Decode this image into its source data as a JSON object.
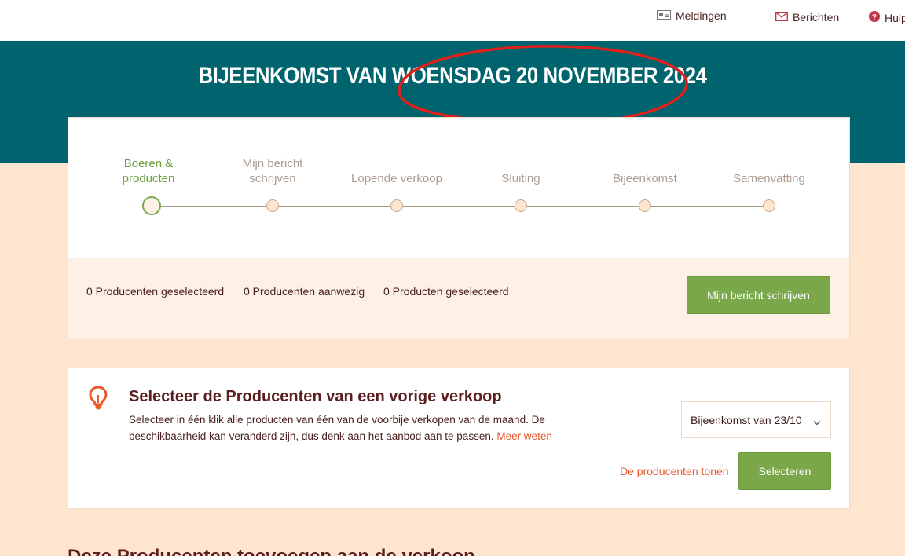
{
  "header": {
    "nav": [
      {
        "label": "Meldingen",
        "icon": "newspaper-icon"
      },
      {
        "label": "Berichten",
        "icon": "envelope-icon"
      },
      {
        "label": "Hulp",
        "icon": "question-circle-icon"
      }
    ]
  },
  "banner": {
    "title": "BIJEENKOMST VAN WOENSDAG 20 NOVEMBER 2024",
    "color": "#00646e"
  },
  "stepper": {
    "steps": [
      {
        "label": "Boeren & producten",
        "active": true
      },
      {
        "label": "Mijn bericht schrijven",
        "active": false
      },
      {
        "label": "Lopende verkoop",
        "active": false
      },
      {
        "label": "Sluiting",
        "active": false
      },
      {
        "label": "Bijeenkomst",
        "active": false
      },
      {
        "label": "Samenvatting",
        "active": false
      }
    ]
  },
  "stats": {
    "producers_selected": "0 Producenten geselecteerd",
    "producers_present": "0 Producenten aanwezig",
    "products_selected": "0 Producten geselecteerd",
    "next_button": "Mijn bericht schrijven"
  },
  "previous_sale": {
    "title": "Selecteer de Producenten van een vorige verkoop",
    "description": "Selecteer in één klik alle producten van één van de voorbije verkopen van de maand. De beschikbaarheid kan veranderd zijn, dus denk aan het aanbod aan te passen.",
    "learn_more": "Meer weten",
    "select_value": "Bijeenkomst van 23/10",
    "show_producers": "De producenten tonen",
    "select_button": "Selecteren"
  },
  "section": {
    "title": "Deze Producenten toevoegen aan de verkoop"
  },
  "colors": {
    "accent_green": "#79a74a",
    "link_orange": "#e8582a",
    "background": "#fde5d0",
    "annotation_red": "#e0201a"
  }
}
